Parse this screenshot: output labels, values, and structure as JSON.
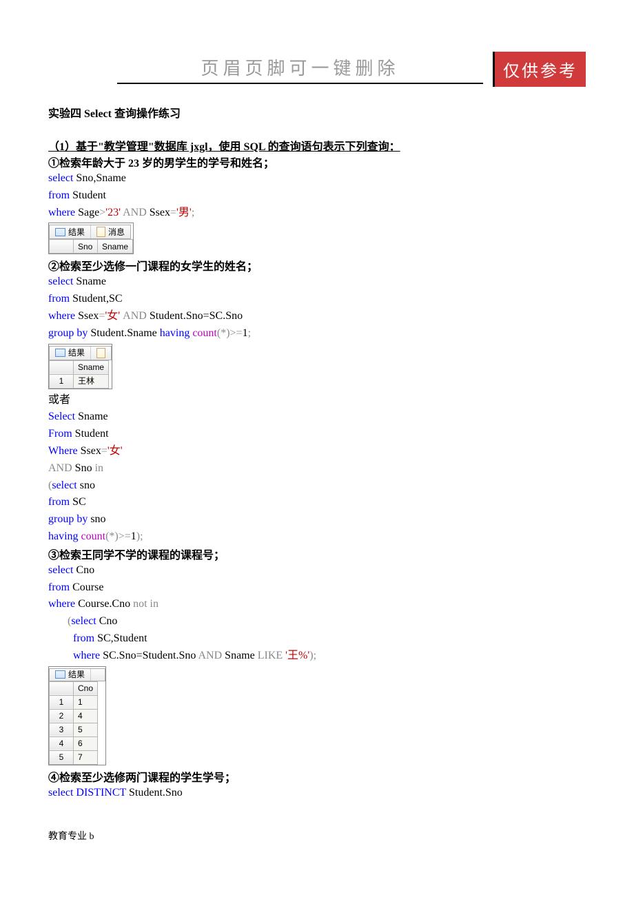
{
  "header": {
    "title_text": "页眉页脚可一键删除",
    "badge_text": "仅供参考"
  },
  "doc_title": "实验四  Select 查询操作练习",
  "section1_heading": "（1）基于\"教学管理\"数据库 jxgl，使用 SQL 的查询语句表示下列查询：",
  "q1": {
    "heading": "①检索年龄大于 23 岁的男学生的学号和姓名；",
    "line1_kw_select": "select",
    "line1_rest": " Sno,Sname",
    "line2_kw_from": "from",
    "line2_rest": " Student",
    "line3_kw_where": "where",
    "line3_sage": " Sage",
    "line3_gt": ">",
    "line3_v23": "'23'",
    "line3_and": " AND ",
    "line3_ssex": "Ssex",
    "line3_eq": "=",
    "line3_male": "'男'",
    "line3_semi": ";",
    "result_tabs": {
      "tab1": "结果",
      "tab2": "消息"
    },
    "result_headers": [
      "Sno",
      "Sname"
    ]
  },
  "q2": {
    "heading": "②检索至少选修一门课程的女学生的姓名；",
    "line1_kw_select": "select",
    "line1_rest": " Sname",
    "line2_kw_from": "from",
    "line2_rest": " Student,SC",
    "line3_kw_where": "where",
    "line3_ssex": " Ssex",
    "line3_eq": "=",
    "line3_female": "'女'",
    "line3_and": " AND ",
    "line3_join": "Student.Sno=SC.Sno",
    "line4_kw_group": "group by",
    "line4_groupcol": " Student.Sname ",
    "line4_kw_having": "having",
    "line4_sp": " ",
    "line4_count": "count",
    "line4_args": "(*)>=",
    "line4_one": "1",
    "line4_semi": ";",
    "result_tab": "结果",
    "result_header": "Sname",
    "result_row1_num": "1",
    "result_row1_val": "王林",
    "or_text": "或者",
    "alt_l1_select": "Select",
    "alt_l1_rest": " Sname",
    "alt_l2_from": "From",
    "alt_l2_rest": " Student",
    "alt_l3_where": "Where",
    "alt_l3_ssex": " Ssex",
    "alt_l3_eq": "=",
    "alt_l3_female": "'女'",
    "alt_l4_and": "AND ",
    "alt_l4_sno": "Sno ",
    "alt_l4_in": "in",
    "alt_l5_open": "(",
    "alt_l5_select": "select",
    "alt_l5_rest": " sno",
    "alt_l6_from": "from",
    "alt_l6_rest": " SC",
    "alt_l7_group": "group by",
    "alt_l7_rest": " sno",
    "alt_l8_having": "having",
    "alt_l8_sp": " ",
    "alt_l8_count": "count",
    "alt_l8_args": "(*)>=",
    "alt_l8_one": "1",
    "alt_l8_close": ");"
  },
  "q3": {
    "heading": "③检索王同学不学的课程的课程号；",
    "l1_select": "select",
    "l1_rest": " Cno",
    "l2_from": "from",
    "l2_rest": " Course",
    "l3_where": "where",
    "l3_ccno": " Course.Cno ",
    "l3_notin": "not in",
    "l4_open": "(",
    "l4_select": "select",
    "l4_rest": " Cno",
    "l5_from": "from",
    "l5_rest": " SC,Student",
    "l6_where": "where",
    "l6_join": " SC.Sno=Student.Sno ",
    "l6_and": "AND ",
    "l6_sname": "Sname ",
    "l6_like": "LIKE",
    "l6_sp": " ",
    "l6_pattern": "'王%'",
    "l6_close": ");",
    "result_tab": "结果",
    "result_header": "Cno",
    "rows": [
      {
        "n": "1",
        "v": "1"
      },
      {
        "n": "2",
        "v": "4"
      },
      {
        "n": "3",
        "v": "5"
      },
      {
        "n": "4",
        "v": "6"
      },
      {
        "n": "5",
        "v": "7"
      }
    ]
  },
  "q4": {
    "heading": "④检索至少选修两门课程的学生学号；",
    "l1_select": "select",
    "l1_distinct": " DISTINCT",
    "l1_rest": " Student.Sno"
  },
  "footer_text": "教育专业 b"
}
